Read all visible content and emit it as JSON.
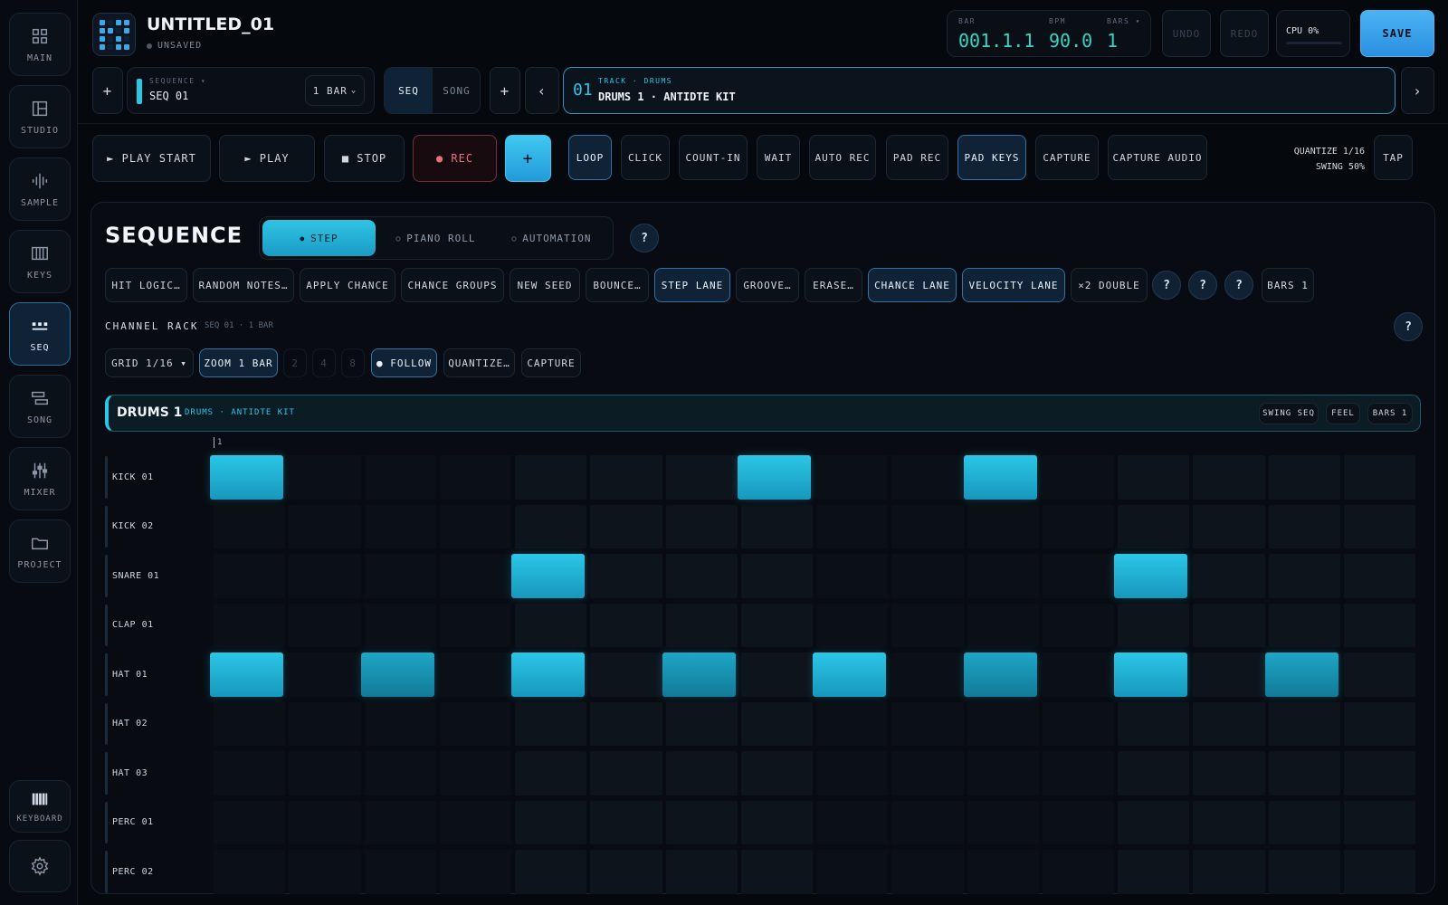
{
  "sidebar": {
    "items": [
      {
        "label": "MAIN",
        "icon": "grid-icon"
      },
      {
        "label": "STUDIO",
        "icon": "layout-icon"
      },
      {
        "label": "SAMPLE",
        "icon": "waveform-icon"
      },
      {
        "label": "KEYS",
        "icon": "piano-icon"
      },
      {
        "label": "SEQ",
        "icon": "sequencer-icon",
        "active": true
      },
      {
        "label": "SONG",
        "icon": "song-icon"
      },
      {
        "label": "MIXER",
        "icon": "mixer-icon"
      },
      {
        "label": "PROJECT",
        "icon": "folder-icon"
      }
    ],
    "keyboard_label": "KEYBOARD",
    "settings_icon": "gear-icon"
  },
  "header": {
    "project_title": "UNTITLED_01",
    "status": "UNSAVED",
    "bar_label": "BAR",
    "bar_value": "001.1.1",
    "bpm_label": "BPM",
    "bpm_value": "90.0",
    "bars_label": "BARS ▾",
    "bars_value": "1",
    "undo": "UNDO",
    "redo": "REDO",
    "cpu": "CPU 0%",
    "save": "SAVE"
  },
  "sequence_bar": {
    "add": "+",
    "sequence_label": "SEQUENCE ▾",
    "sequence_value": "SEQ 01",
    "length": "1 BAR",
    "mode_seq": "SEQ",
    "mode_song": "SONG",
    "add2": "+",
    "prev": "‹",
    "next": "›",
    "track_number": "01",
    "track_label": "TRACK · DRUMS",
    "track_name": "DRUMS 1 · ANTIDTE KIT"
  },
  "transport": {
    "play_start": "► PLAY START",
    "play": "► PLAY",
    "stop": "■ STOP",
    "rec": "● REC",
    "plus": "+",
    "toggles": [
      "LOOP",
      "CLICK",
      "COUNT-IN",
      "WAIT",
      "AUTO REC",
      "PAD REC",
      "PAD KEYS",
      "CAPTURE",
      "CAPTURE AUDIO"
    ],
    "quantize": "QUANTIZE 1/16",
    "swing": "SWING 50%",
    "tap": "TAP"
  },
  "sequence_panel": {
    "title": "SEQUENCE",
    "tabs": [
      "STEP",
      "PIANO ROLL",
      "AUTOMATION"
    ],
    "help": "?",
    "tools": [
      "HIT LOGIC…",
      "RANDOM NOTES…",
      "APPLY CHANCE",
      "CHANCE GROUPS",
      "NEW SEED",
      "BOUNCE…",
      "STEP LANE",
      "GROOVE…",
      "ERASE…",
      "CHANCE LANE",
      "VELOCITY LANE",
      "×2 DOUBLE"
    ],
    "tool_help": [
      "?",
      "?",
      "?"
    ],
    "bars": "BARS 1",
    "channel_rack_label": "CHANNEL RACK",
    "channel_rack_sub": "SEQ 01 · 1 BAR",
    "grid": "GRID 1/16 ▾",
    "zoom": "ZOOM 1 BAR",
    "zoom_options": [
      "2",
      "4",
      "8"
    ],
    "follow": "● FOLLOW",
    "quantize": "QUANTIZE…",
    "capture": "CAPTURE",
    "track_name": "DRUMS 1",
    "track_sub": "DRUMS · ANTIDTE KIT",
    "swing_seq": "SWING SEQ",
    "feel": "FEEL",
    "track_bars": "BARS 1",
    "bar_marker": "1",
    "rows": [
      {
        "name": "KICK 01",
        "steps": [
          0,
          7,
          10
        ]
      },
      {
        "name": "KICK 02",
        "steps": []
      },
      {
        "name": "SNARE 01",
        "steps": [
          4,
          12
        ]
      },
      {
        "name": "CLAP 01",
        "steps": []
      },
      {
        "name": "HAT 01",
        "steps": [
          0,
          2,
          4,
          6,
          8,
          10,
          12,
          14
        ]
      },
      {
        "name": "HAT 02",
        "steps": []
      },
      {
        "name": "HAT 03",
        "steps": []
      },
      {
        "name": "PERC 01",
        "steps": []
      },
      {
        "name": "PERC 02",
        "steps": []
      }
    ],
    "dim_steps": {
      "4": [
        2,
        6,
        10,
        14
      ]
    }
  },
  "colors": {
    "accent": "#2bc6e6",
    "save_bg": "#3aa9f0",
    "rec": "#e0606e",
    "readout": "#36d6c4"
  }
}
